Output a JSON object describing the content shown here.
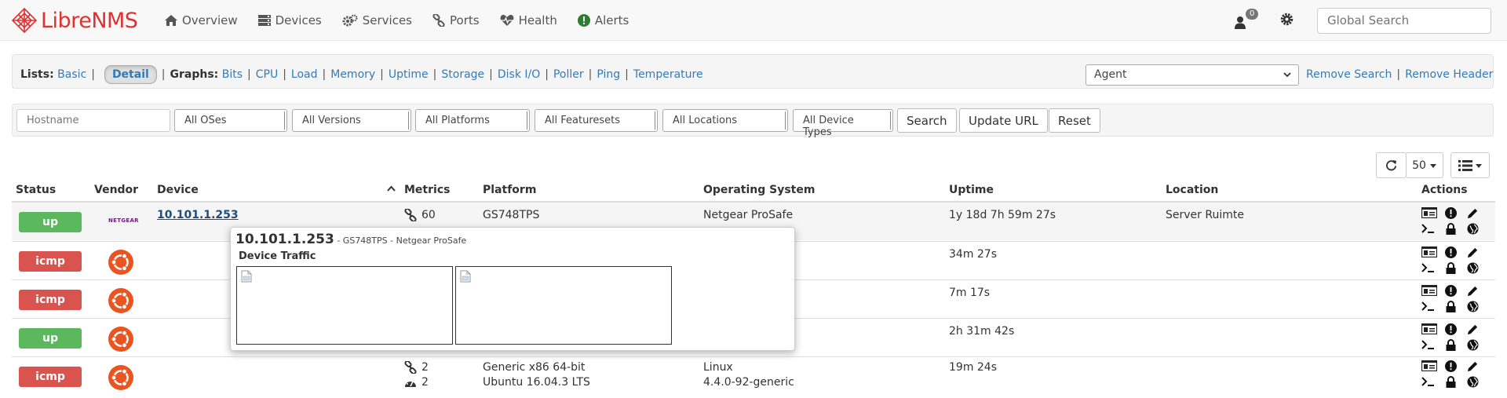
{
  "brand": {
    "part1": "Libre",
    "part2": "NMS"
  },
  "nav": {
    "items": [
      {
        "label": "Overview",
        "icon": "home-icon"
      },
      {
        "label": "Devices",
        "icon": "server-icon"
      },
      {
        "label": "Services",
        "icon": "cogs-icon"
      },
      {
        "label": "Ports",
        "icon": "link-icon"
      },
      {
        "label": "Health",
        "icon": "heartbeat-icon"
      },
      {
        "label": "Alerts",
        "icon": "exclamation-circle-icon"
      }
    ],
    "notification_count": "0",
    "global_search_placeholder": "Global Search"
  },
  "lists_bar": {
    "lists_label": "Lists:",
    "basic": "Basic",
    "detail": "Detail",
    "graphs_label": "Graphs:",
    "graphs": [
      "Bits",
      "CPU",
      "Load",
      "Memory",
      "Uptime",
      "Storage",
      "Disk I/O",
      "Poller",
      "Ping",
      "Temperature"
    ],
    "agent_selected": "Agent",
    "remove_search": "Remove Search",
    "remove_header": "Remove Header"
  },
  "filters": {
    "hostname_placeholder": "Hostname",
    "os": "All OSes",
    "versions": "All Versions",
    "platforms": "All Platforms",
    "featuresets": "All Featuresets",
    "locations": "All Locations",
    "device_types": "All Device Types",
    "search_btn": "Search",
    "update_url_btn": "Update URL",
    "reset_btn": "Reset"
  },
  "table_controls": {
    "page_size": "50"
  },
  "table": {
    "columns": [
      "Status",
      "Vendor",
      "Device",
      "Metrics",
      "Platform",
      "Operating System",
      "Uptime",
      "Location",
      "Actions"
    ],
    "rows": [
      {
        "status": "up",
        "vendor": "NETGEAR",
        "device": "10.101.1.253",
        "ports": "60",
        "health": "",
        "platform": "GS748TPS",
        "platform2": "",
        "os": "Netgear ProSafe",
        "os2": "",
        "uptime": "1y 18d 7h 59m 27s",
        "location": "Server Ruimte"
      },
      {
        "status": "icmp",
        "vendor": "ubuntu",
        "device": "",
        "ports": "",
        "health": "",
        "platform": "",
        "platform2": "",
        "os": "",
        "os2": "",
        "uptime": "34m 27s",
        "location": ""
      },
      {
        "status": "icmp",
        "vendor": "ubuntu",
        "device": "",
        "ports": "",
        "health": "",
        "platform": "",
        "platform2": "",
        "os": "",
        "os2": "",
        "uptime": "7m 17s",
        "location": ""
      },
      {
        "status": "up",
        "vendor": "ubuntu",
        "device": "",
        "ports": "",
        "health": "",
        "platform": "",
        "platform2": "",
        "os": "",
        "os2": "",
        "uptime": "2h 31m 42s",
        "location": ""
      },
      {
        "status": "icmp",
        "vendor": "ubuntu",
        "device": "",
        "ports": "2",
        "health": "2",
        "platform": "Generic x86 64-bit",
        "platform2": "Ubuntu 16.04.3 LTS",
        "os": "Linux",
        "os2": "4.4.0-92-generic",
        "uptime": "19m 24s",
        "location": ""
      }
    ]
  },
  "popup": {
    "title": "10.101.1.253",
    "subtitle": " - GS748TPS - Netgear ProSafe",
    "section": "Device Traffic"
  },
  "colors": {
    "up": "#5cb85c",
    "icmp": "#d9534f",
    "link": "#337ab7",
    "brand": "#e03030",
    "ubuntu": "#e95420"
  }
}
